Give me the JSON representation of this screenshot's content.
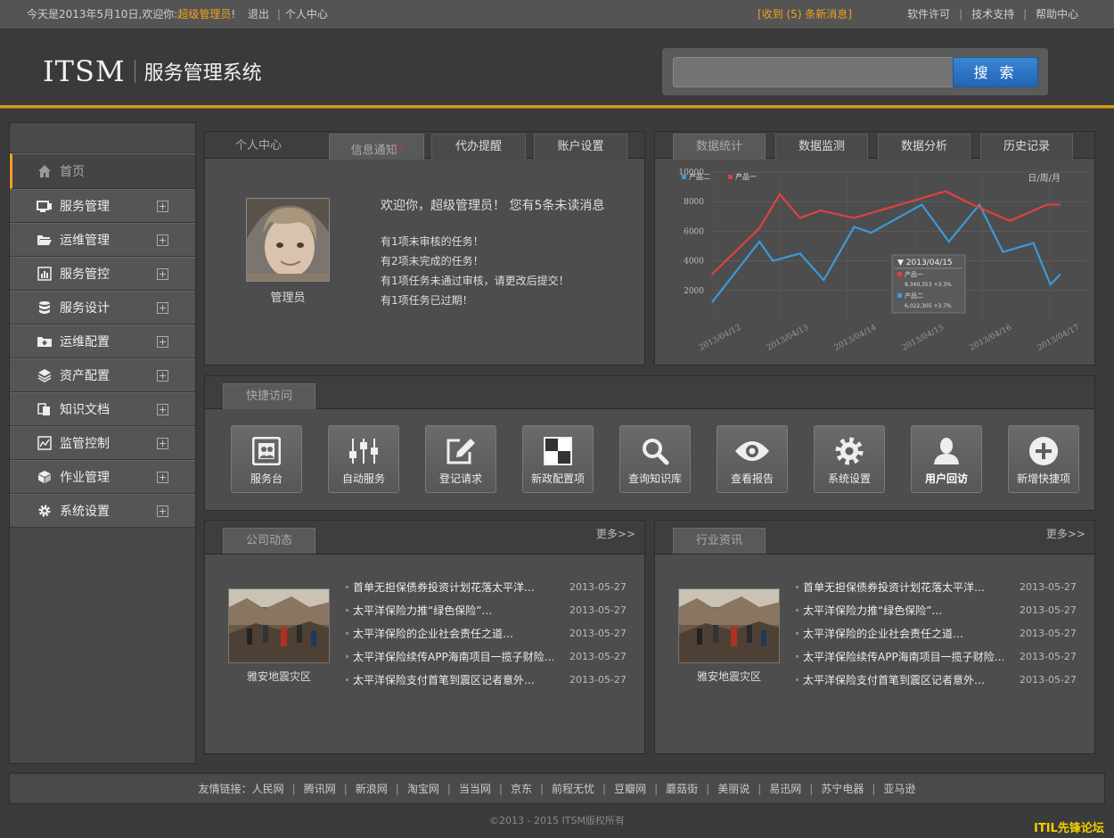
{
  "topbar": {
    "greeting_prefix": "今天是2013年5月10日,欢迎你:",
    "user_name": "超级管理员",
    "exclaim": "!",
    "logout": "退出",
    "divider": "|",
    "personal_center": "个人中心",
    "messages": "[收到 (5) 条新消息]",
    "software_license": "软件许可",
    "tech_support": "技术支持",
    "help_center": "帮助中心"
  },
  "header": {
    "logo_text": "ITSM",
    "system_name": "服务管理系统",
    "search_placeholder": "",
    "search_button": "搜 索"
  },
  "sidebar": {
    "items": [
      {
        "label": "首页",
        "icon": "home-icon",
        "expandable": false
      },
      {
        "label": "服务管理",
        "icon": "monitor-icon",
        "expandable": true
      },
      {
        "label": "运维管理",
        "icon": "folder-open-icon",
        "expandable": true
      },
      {
        "label": "服务管控",
        "icon": "bar-chart-icon",
        "expandable": true
      },
      {
        "label": "服务设计",
        "icon": "database-icon",
        "expandable": true
      },
      {
        "label": "运维配置",
        "icon": "folder-plus-icon",
        "expandable": true
      },
      {
        "label": "资产配置",
        "icon": "layers-icon",
        "expandable": true
      },
      {
        "label": "知识文档",
        "icon": "documents-icon",
        "expandable": true
      },
      {
        "label": "监管控制",
        "icon": "line-chart-icon",
        "expandable": true
      },
      {
        "label": "作业管理",
        "icon": "cube-icon",
        "expandable": true
      },
      {
        "label": "系统设置",
        "icon": "gear-icon",
        "expandable": true
      }
    ],
    "expand_symbol": "+"
  },
  "personal": {
    "tabs": [
      "个人中心",
      "信息通知",
      "代办提醒",
      "账户设置"
    ],
    "notify_count": "5",
    "avatar_caption": "管理员",
    "welcome": "欢迎你，超级管理员！ 您有5条未读消息",
    "tasks": [
      "有1项未审核的任务！",
      "有2项未完成的任务！",
      "有1项任务未通过审核，请更改后提交！",
      "有1项任务已过期！"
    ]
  },
  "stats": {
    "tabs": [
      "数据统计",
      "数据监测",
      "数据分析",
      "历史记录"
    ],
    "period": "日/周/月",
    "tooltip": {
      "date": "2013/04/15",
      "s1_label": "产品一",
      "s1_value": "8,340,353 +3.3%",
      "s2_label": "产品二",
      "s2_value": "6,022,305 +3.7%"
    }
  },
  "chart_data": {
    "type": "line",
    "x": [
      "2013/04/12",
      "2013/04/13",
      "2013/04/14",
      "2013/04/15",
      "2013/04/16",
      "2013/04/17"
    ],
    "ylim": [
      0,
      10000
    ],
    "yticks": [
      2000,
      4000,
      6000,
      8000,
      10000
    ],
    "series": [
      {
        "name": "产品二",
        "color": "#3a9ad9",
        "points": [
          [
            0,
            1200
          ],
          [
            0.7,
            5300
          ],
          [
            0.9,
            4000
          ],
          [
            1.3,
            4500
          ],
          [
            1.65,
            2700
          ],
          [
            2.1,
            6300
          ],
          [
            2.35,
            5900
          ],
          [
            3.1,
            7800
          ],
          [
            3.5,
            5300
          ],
          [
            3.95,
            7800
          ],
          [
            4.3,
            4600
          ],
          [
            4.75,
            5200
          ],
          [
            5.0,
            2400
          ],
          [
            5.15,
            3100
          ]
        ]
      },
      {
        "name": "产品一",
        "color": "#e04040",
        "points": [
          [
            0,
            3100
          ],
          [
            0.7,
            6200
          ],
          [
            1.0,
            8500
          ],
          [
            1.3,
            6900
          ],
          [
            1.6,
            7400
          ],
          [
            2.1,
            6900
          ],
          [
            3.45,
            8700
          ],
          [
            3.85,
            7800
          ],
          [
            4.4,
            6700
          ],
          [
            4.95,
            7800
          ],
          [
            5.15,
            7800
          ]
        ]
      }
    ],
    "legend_position": "top-left",
    "grid": true
  },
  "quick": {
    "title": "快捷访问",
    "items": [
      {
        "label": "服务台",
        "icon": "desk-icon"
      },
      {
        "label": "自动服务",
        "icon": "sliders-icon"
      },
      {
        "label": "登记请求",
        "icon": "edit-icon"
      },
      {
        "label": "新政配置项",
        "icon": "grid-icon"
      },
      {
        "label": "查询知识库",
        "icon": "search-icon"
      },
      {
        "label": "查看报告",
        "icon": "eye-icon"
      },
      {
        "label": "系统设置",
        "icon": "gear-icon"
      },
      {
        "label": "用户回访",
        "icon": "user-icon"
      },
      {
        "label": "新增快捷项",
        "icon": "plus-circle-icon"
      }
    ]
  },
  "company_news": {
    "title": "公司动态",
    "more": "更多>>",
    "caption": "雅安地震灾区",
    "items": [
      {
        "title": "首单无担保债券投资计划花落太平洋…",
        "date": "2013-05-27"
      },
      {
        "title": "太平洋保险力推“绿色保险”…",
        "date": "2013-05-27"
      },
      {
        "title": "太平洋保险的企业社会责任之道…",
        "date": "2013-05-27"
      },
      {
        "title": "太平洋保险续传APP海南项目一揽子财险…",
        "date": "2013-05-27"
      },
      {
        "title": "太平洋保险支付首笔到震区记者意外…",
        "date": "2013-05-27"
      }
    ]
  },
  "industry_news": {
    "title": "行业资讯",
    "more": "更多>>",
    "caption": "雅安地震灾区",
    "items": [
      {
        "title": "首单无担保债券投资计划花落太平洋…",
        "date": "2013-05-27"
      },
      {
        "title": "太平洋保险力推“绿色保险”…",
        "date": "2013-05-27"
      },
      {
        "title": "太平洋保险的企业社会责任之道…",
        "date": "2013-05-27"
      },
      {
        "title": "太平洋保险续传APP海南项目一揽子财险…",
        "date": "2013-05-27"
      },
      {
        "title": "太平洋保险支付首笔到震区记者意外…",
        "date": "2013-05-27"
      }
    ]
  },
  "footer": {
    "links_label": "友情链接：",
    "links": [
      "人民网",
      "腾讯网",
      "新浪网",
      "淘宝网",
      "当当网",
      "京东",
      "前程无忧",
      "豆瓣网",
      "蘑菇街",
      "美丽说",
      "易迅网",
      "苏宁电器",
      "亚马逊"
    ],
    "copyright": "©2013 - 2015 ITSM版权所有",
    "watermark": "ITIL先锋论坛"
  },
  "colors": {
    "accent": "#f0a020",
    "search_button": "#2a6fc0"
  }
}
